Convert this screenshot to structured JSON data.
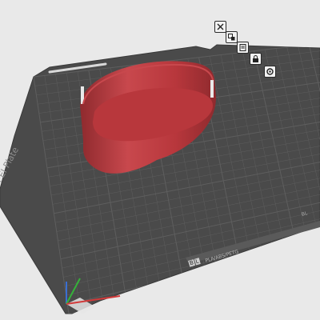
{
  "viewport": {
    "background_color": "#e9e9e9",
    "plate_color": "#4a4a4a",
    "plate_edge_color": "#3a3a3a",
    "grid_color": "#5e5e5e",
    "model_color": "#b8373c",
    "model_shadow_color": "#8f2a2e",
    "model_highlight_color": "#c8484d"
  },
  "plate": {
    "name_label": "PEI Plate",
    "material_label": "PLA/ABS/PETG",
    "logo_letters": [
      "B",
      "L"
    ],
    "small_badge": "BL"
  },
  "toolbar": {
    "buttons": [
      {
        "name": "close-plate-icon",
        "title": "delete"
      },
      {
        "name": "arrange-icon",
        "title": "arrange"
      },
      {
        "name": "orient-icon",
        "title": "orient"
      },
      {
        "name": "lock-icon",
        "title": "lock"
      },
      {
        "name": "settings-icon",
        "title": "settings"
      }
    ]
  },
  "axes": {
    "x_color": "#d23a3a",
    "y_color": "#35b13a",
    "z_color": "#3a6fd2"
  }
}
